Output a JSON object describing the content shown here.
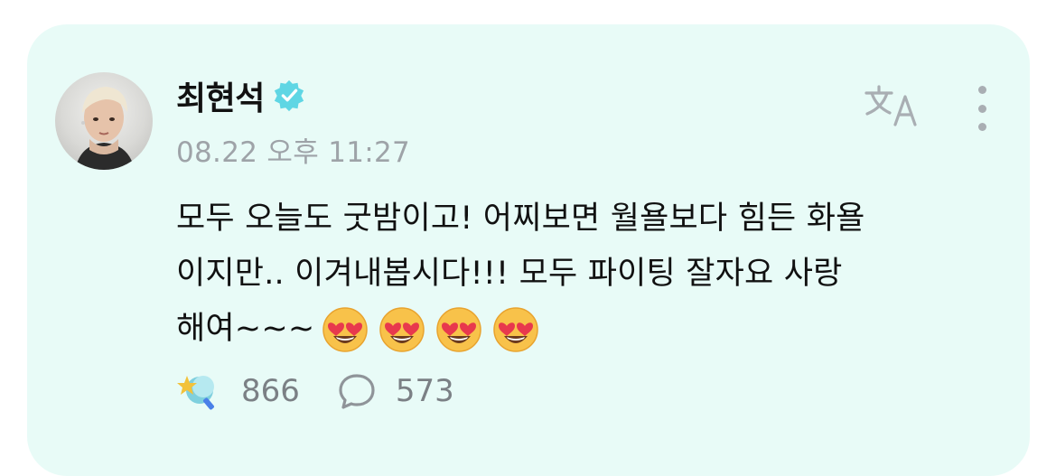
{
  "post": {
    "author": "최현석",
    "timestamp": "08.22 오후 11:27",
    "body_lines": [
      "모두 오늘도 굿밤이고! 어찌보면 월욜보다 힘든 화욜",
      "이지만.. 이겨내봅시다!!! 모두 파이팅 잘자요 사랑",
      "해여~~~"
    ],
    "emoji_count": 4,
    "emoji_name": "smiling-face-with-heart-eyes",
    "likes": "866",
    "comments": "573"
  },
  "colors": {
    "card_bg": "#e8fbf7",
    "verified": "#5fd6e4",
    "muted": "#9ea3a8"
  },
  "icons": {
    "verified": "verified-badge-icon",
    "translate": "translate-icon",
    "more": "more-vertical-icon",
    "like": "star-lollipop-icon",
    "comment": "comment-bubble-icon"
  }
}
